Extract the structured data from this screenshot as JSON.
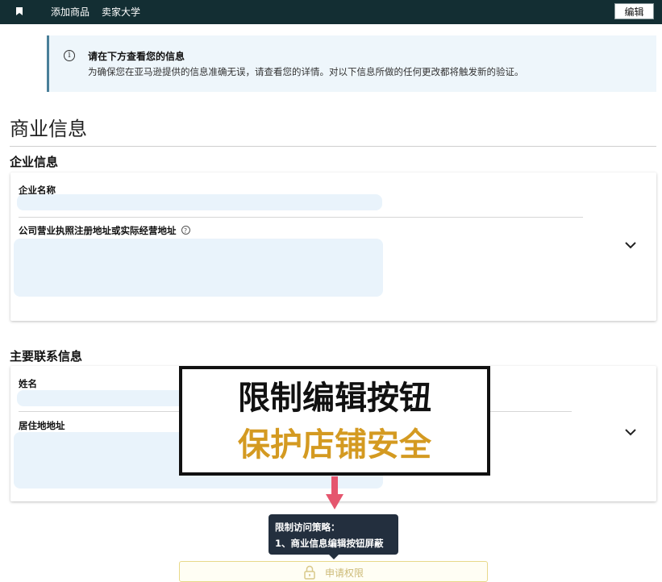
{
  "topbar": {
    "bookmark_icon": "bookmark-icon",
    "nav_items": [
      "添加商品",
      "卖家大学"
    ],
    "edit_label": "编辑"
  },
  "info": {
    "icon": "info-icon",
    "title": "请在下方查看您的信息",
    "text": "为确保您在亚马逊提供的信息准确无误，请查看您的详情。对以下信息所做的任何更改都将触发新的验证。"
  },
  "page": {
    "title": "商业信息"
  },
  "business": {
    "section_title": "企业信息",
    "fields": [
      {
        "label": "企业名称"
      },
      {
        "label": "公司营业执照注册地址或实际经营地址"
      }
    ]
  },
  "contact": {
    "section_title": "主要联系信息",
    "fields": [
      {
        "label": "姓名"
      },
      {
        "label": "居住地地址"
      }
    ]
  },
  "overlay": {
    "line1": "限制编辑按钮",
    "line2": "保护店铺安全",
    "accent_color": "#d49a21"
  },
  "tooltip": {
    "line1": "限制访问策略：",
    "line2": "1、商业信息编辑按钮屏蔽"
  },
  "apply": {
    "icon": "lock-icon",
    "label": "申请权限"
  },
  "colors": {
    "topbar": "#132e33",
    "info_bg": "#eef6fb",
    "redacted": "#e9f3fb",
    "arrow": "#e5566e",
    "tooltip_bg": "#232f3e"
  }
}
